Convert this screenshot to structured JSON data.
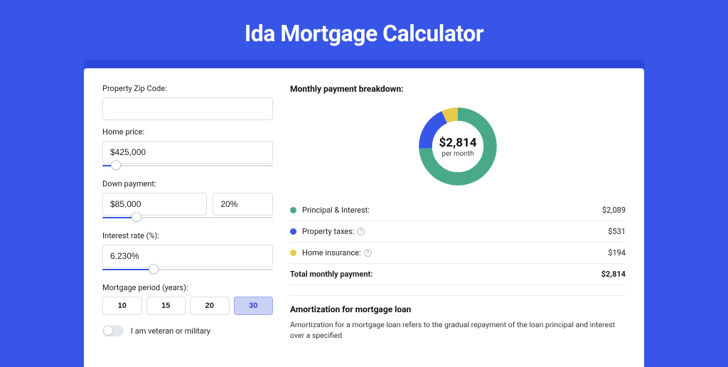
{
  "title": "Ida Mortgage Calculator",
  "form": {
    "zip": {
      "label": "Property Zip Code:",
      "value": ""
    },
    "home_price": {
      "label": "Home price:",
      "value": "$425,000",
      "slider_pct": 8
    },
    "down_payment": {
      "label": "Down payment:",
      "value": "$85,000",
      "pct": "20%",
      "slider_pct": 20
    },
    "interest_rate": {
      "label": "Interest rate (%):",
      "value": "6.230%",
      "slider_pct": 30
    },
    "period": {
      "label": "Mortgage period (years):",
      "options": [
        "10",
        "15",
        "20",
        "30"
      ],
      "selected": "30"
    },
    "veteran": {
      "label": "I am veteran or military",
      "value": false
    }
  },
  "breakdown": {
    "title": "Monthly payment breakdown:",
    "center_amount": "$2,814",
    "center_sub": "per month",
    "items": [
      {
        "label": "Principal & Interest:",
        "value": "$2,089",
        "color": "#49a98a",
        "pct": 74,
        "info": false
      },
      {
        "label": "Property taxes:",
        "value": "$531",
        "color": "#3755e6",
        "pct": 19,
        "info": true
      },
      {
        "label": "Home insurance:",
        "value": "$194",
        "color": "#e9c94b",
        "pct": 7,
        "info": true
      }
    ],
    "total_label": "Total monthly payment:",
    "total_value": "$2,814"
  },
  "amortization": {
    "title": "Amortization for mortgage loan",
    "text": "Amortization for a mortgage loan refers to the gradual repayment of the loan principal and interest over a specified"
  },
  "chart_data": {
    "type": "pie",
    "title": "Monthly payment breakdown",
    "series": [
      {
        "name": "Principal & Interest",
        "value": 2089,
        "color": "#49a98a"
      },
      {
        "name": "Property taxes",
        "value": 531,
        "color": "#3755e6"
      },
      {
        "name": "Home insurance",
        "value": 194,
        "color": "#e9c94b"
      }
    ],
    "total": 2814,
    "center_label": "$2,814 per month"
  }
}
